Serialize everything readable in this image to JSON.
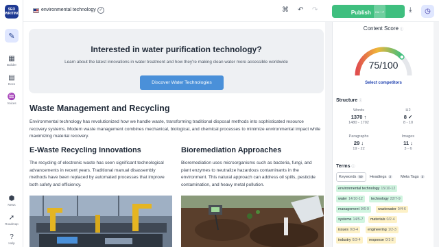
{
  "app": {
    "logo_text": "SEO WRITING"
  },
  "rail": {
    "items": [
      {
        "label": "Builder",
        "icon": "builder-icon"
      },
      {
        "label": "Docs",
        "icon": "docs-icon"
      },
      {
        "label": "Voices",
        "icon": "voices-icon"
      },
      {
        "label": "News",
        "icon": "news-icon"
      },
      {
        "label": "Roadmap",
        "icon": "roadmap-icon"
      },
      {
        "label": "Help",
        "icon": "help-icon"
      }
    ]
  },
  "topbar": {
    "keyword": "environmental technology"
  },
  "publish": {
    "label": "Publish",
    "shortcut": "Ctrl + P"
  },
  "article": {
    "cta_title": "Interested in water purification technology?",
    "cta_subtitle": "Learn about the latest innovations in water treatment and how they're making clean water more accessible worldwide",
    "cta_button": "Discover Water Technologies",
    "h2": "Waste Management and Recycling",
    "para": "Environmental technology has revolutionized how we handle waste, transforming traditional disposal methods into sophisticated resource recovery systems. Modern waste management combines mechanical, biological, and chemical processes to minimize environmental impact while maximizing material recovery.",
    "col1_title": "E-Waste Recycling Innovations",
    "col1_text": "The recycling of electronic waste has seen significant technological advancements in recent years. Traditional manual disassembly methods have been replaced by automated processes that improve both safety and efficiency.",
    "col2_title": "Bioremediation Approaches",
    "col2_text": "Bioremediation uses microorganisms such as bacteria, fungi, and plant enzymes to neutralize hazardous contaminants in the environment. This natural approach can address oil spills, pesticide contamination, and heavy metal pollution."
  },
  "panel": {
    "title": "Content Score",
    "score": "75/100",
    "score_value": 75,
    "select_competitors": "Select competitors",
    "structure_title": "Structure",
    "metrics": [
      {
        "label": "Words",
        "value": "1370 ↑",
        "range": "1480 - 1702"
      },
      {
        "label": "H2",
        "value": "8 ✓",
        "range": "8 - 10"
      },
      {
        "label": "Paragraphs",
        "value": "29 ↓",
        "range": "19 - 22"
      },
      {
        "label": "Images",
        "value": "11 ↓",
        "range": "3 - 6"
      }
    ],
    "terms_title": "Terms",
    "tabs": [
      {
        "label": "Keywords",
        "count": "50"
      },
      {
        "label": "Headings",
        "count": "3"
      },
      {
        "label": "Meta Tags",
        "count": "3"
      }
    ],
    "chips": [
      {
        "term": "environmental technology",
        "ratio": "15/10-12",
        "status": "green"
      },
      {
        "term": "water",
        "ratio": "14/10-12",
        "status": "green"
      },
      {
        "term": "technology",
        "ratio": "22/7-9",
        "status": "green"
      },
      {
        "term": "management",
        "ratio": "9/6-9",
        "status": "green"
      },
      {
        "term": "wastewater",
        "ratio": "0/4-6",
        "status": "yellow"
      },
      {
        "term": "systems",
        "ratio": "14/5-7",
        "status": "green"
      },
      {
        "term": "materials",
        "ratio": "0/2-4",
        "status": "yellow"
      },
      {
        "term": "issues",
        "ratio": "0/3-4",
        "status": "yellow"
      },
      {
        "term": "engineering",
        "ratio": "1/2-3",
        "status": "yellow"
      },
      {
        "term": "industry",
        "ratio": "0/3-4",
        "status": "yellow"
      },
      {
        "term": "response",
        "ratio": "0/1-2",
        "status": "yellow"
      }
    ]
  },
  "colors": {
    "publish": "#3fbf7f",
    "cta_button": "#4a90d9",
    "accent": "#1e40af",
    "good": "#d1f5e0",
    "warn": "#fdf1c7"
  }
}
